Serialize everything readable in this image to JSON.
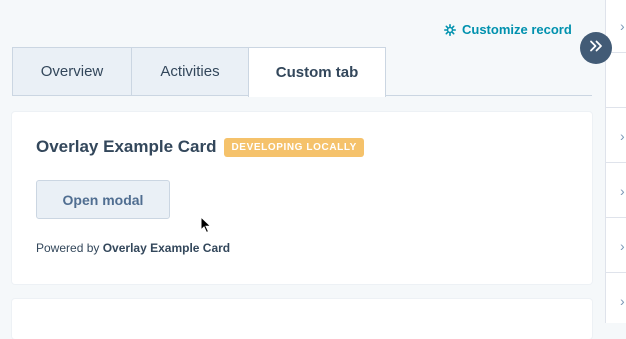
{
  "header": {
    "customize_label": "Customize record"
  },
  "tabs": [
    {
      "label": "Overview"
    },
    {
      "label": "Activities"
    },
    {
      "label": "Custom tab"
    }
  ],
  "card": {
    "title": "Overlay Example Card",
    "badge": "DEVELOPING LOCALLY",
    "button_label": "Open modal",
    "powered_prefix": "Powered by",
    "powered_name": "Overlay Example Card"
  },
  "colors": {
    "accent": "#0091ae",
    "badge": "#f5c26b",
    "expand_button": "#425b76"
  },
  "icons": {
    "customize": "gear-icon",
    "expand": "double-chevron-right-icon",
    "side_panel": "chevron-right-icon"
  }
}
